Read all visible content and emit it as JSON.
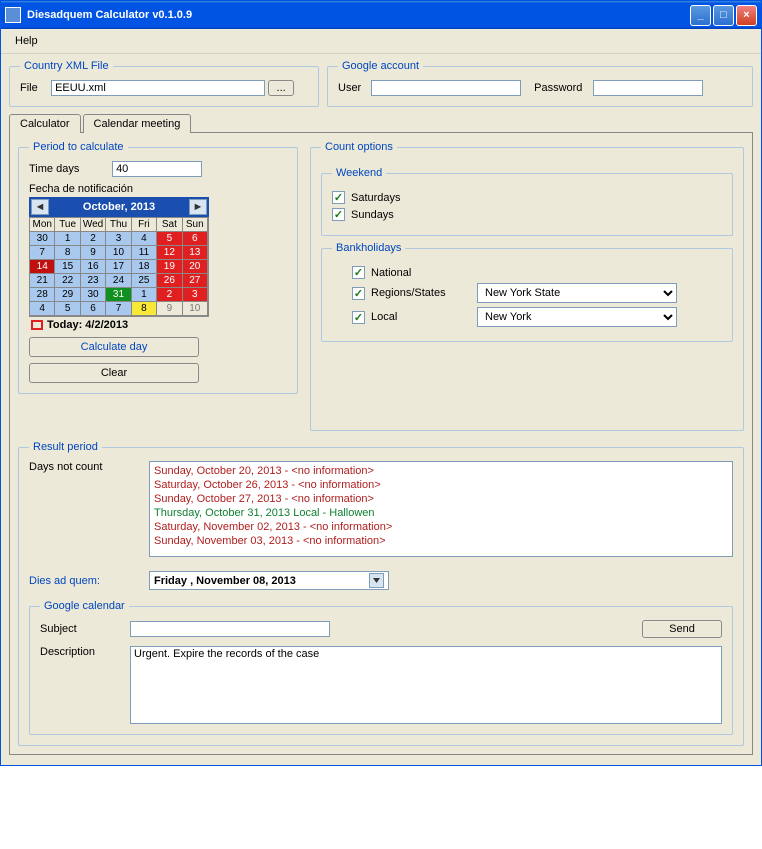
{
  "window": {
    "title": "Diesadquem Calculator v0.1.0.9"
  },
  "menu": {
    "help": "Help"
  },
  "country_file": {
    "legend": "Country XML File",
    "file_label": "File",
    "file_value": "EEUU.xml",
    "browse": "..."
  },
  "google_acct": {
    "legend": "Google account",
    "user_label": "User",
    "user_value": "",
    "pw_label": "Password",
    "pw_value": ""
  },
  "tabs": {
    "calculator": "Calculator",
    "meeting": "Calendar meeting"
  },
  "period": {
    "legend": "Period to calculate",
    "time_days_label": "Time days",
    "time_days_value": "40",
    "fecha_label": "Fecha de notificación",
    "cal_title": "October, 2013",
    "dow": [
      "Mon",
      "Tue",
      "Wed",
      "Thu",
      "Fri",
      "Sat",
      "Sun"
    ],
    "cells": [
      {
        "n": "30",
        "c": "c-blue"
      },
      {
        "n": "1",
        "c": "c-blue"
      },
      {
        "n": "2",
        "c": "c-blue"
      },
      {
        "n": "3",
        "c": "c-blue"
      },
      {
        "n": "4",
        "c": "c-blue"
      },
      {
        "n": "5",
        "c": "c-red"
      },
      {
        "n": "6",
        "c": "c-red"
      },
      {
        "n": "7",
        "c": "c-blue"
      },
      {
        "n": "8",
        "c": "c-blue"
      },
      {
        "n": "9",
        "c": "c-blue"
      },
      {
        "n": "10",
        "c": "c-blue"
      },
      {
        "n": "11",
        "c": "c-blue"
      },
      {
        "n": "12",
        "c": "c-red"
      },
      {
        "n": "13",
        "c": "c-red"
      },
      {
        "n": "14",
        "c": "c-darkred"
      },
      {
        "n": "15",
        "c": "c-blue"
      },
      {
        "n": "16",
        "c": "c-blue"
      },
      {
        "n": "17",
        "c": "c-blue"
      },
      {
        "n": "18",
        "c": "c-blue"
      },
      {
        "n": "19",
        "c": "c-red"
      },
      {
        "n": "20",
        "c": "c-red"
      },
      {
        "n": "21",
        "c": "c-blue"
      },
      {
        "n": "22",
        "c": "c-blue"
      },
      {
        "n": "23",
        "c": "c-blue"
      },
      {
        "n": "24",
        "c": "c-blue"
      },
      {
        "n": "25",
        "c": "c-blue"
      },
      {
        "n": "26",
        "c": "c-red"
      },
      {
        "n": "27",
        "c": "c-red"
      },
      {
        "n": "28",
        "c": "c-blue"
      },
      {
        "n": "29",
        "c": "c-blue"
      },
      {
        "n": "30",
        "c": "c-blue"
      },
      {
        "n": "31",
        "c": "c-green"
      },
      {
        "n": "1",
        "c": "c-blue"
      },
      {
        "n": "2",
        "c": "c-red"
      },
      {
        "n": "3",
        "c": "c-red"
      },
      {
        "n": "4",
        "c": "c-blue"
      },
      {
        "n": "5",
        "c": "c-blue"
      },
      {
        "n": "6",
        "c": "c-blue"
      },
      {
        "n": "7",
        "c": "c-blue"
      },
      {
        "n": "8",
        "c": "c-yellow"
      },
      {
        "n": "9",
        "c": "c-gray"
      },
      {
        "n": "10",
        "c": "c-gray"
      }
    ],
    "today_label": "Today: 4/2/2013",
    "calc_btn": "Calculate day",
    "clear_btn": "Clear"
  },
  "count": {
    "legend": "Count options",
    "weekend_legend": "Weekend",
    "sat": "Saturdays",
    "sun": "Sundays",
    "bank_legend": "Bankholidays",
    "national": "National",
    "regions": "Regions/States",
    "local": "Local",
    "region_sel": "New York State",
    "local_sel": "New York"
  },
  "result": {
    "legend": "Result period",
    "not_count_label": "Days not count",
    "lines": [
      {
        "text": "Sunday, October 20, 2013    - <no information>",
        "cls": "res-red"
      },
      {
        "text": "Saturday, October 26, 2013    - <no information>",
        "cls": "res-red"
      },
      {
        "text": "Sunday, October 27, 2013    - <no information>",
        "cls": "res-red"
      },
      {
        "text": "Thursday, October 31, 2013   Local - Hallowen",
        "cls": "res-green"
      },
      {
        "text": "Saturday, November 02, 2013    - <no information>",
        "cls": "res-red"
      },
      {
        "text": "Sunday, November 03, 2013    - <no information>",
        "cls": "res-red"
      }
    ],
    "dies_label": "Dies ad quem:",
    "dies_value": "Friday   , November 08, 2013"
  },
  "gcal": {
    "legend": "Google calendar",
    "subject_label": "Subject",
    "subject_value": "",
    "desc_label": "Description",
    "desc_value": "Urgent. Expire the records of the case",
    "send_btn": "Send"
  }
}
